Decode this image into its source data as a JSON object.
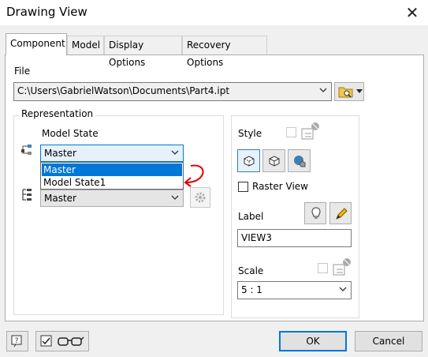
{
  "window": {
    "title": "Drawing View",
    "close_glyph": "✕"
  },
  "tabs": [
    "Component",
    "Model",
    "Display Options",
    "Recovery Options"
  ],
  "component": {
    "file_label": "File",
    "file_path": "C:\\Users\\GabrielWatson\\Documents\\Part4.ipt",
    "representation_label": "Representation",
    "model_state_label": "Model State",
    "model_state_value": "Master",
    "model_state_options": [
      "Master",
      "Model State1"
    ],
    "design_view_value": "Master",
    "style_label": "Style",
    "raster_view_label": "Raster View",
    "label_label": "Label",
    "label_value": "VIEW3",
    "scale_label": "Scale",
    "scale_value": "5 : 1"
  },
  "footer": {
    "ok_label": "OK",
    "cancel_label": "Cancel"
  },
  "icons": {
    "close": "close-icon",
    "browse": "folder-icon",
    "help": "help-icon",
    "preview": "glasses-icon"
  },
  "colors": {
    "accent": "#0078d7",
    "annotation": "#e00000"
  }
}
